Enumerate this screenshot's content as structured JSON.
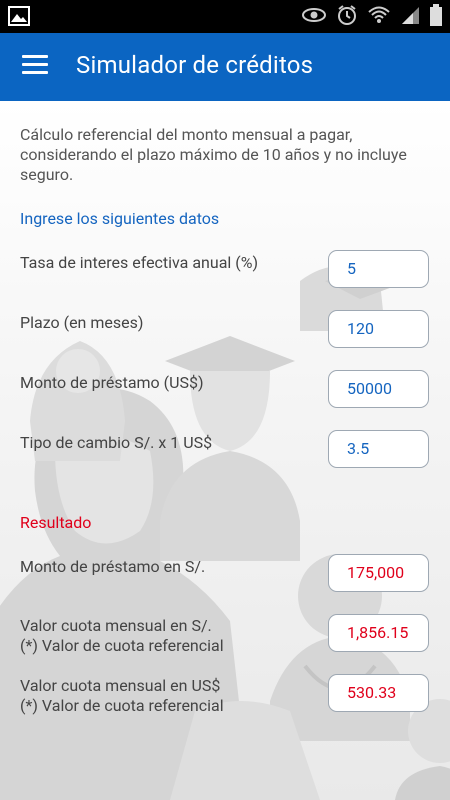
{
  "app": {
    "title": "Simulador de créditos"
  },
  "intro_text": "Cálculo referencial del monto mensual a pagar, considerando el plazo máximo de 10 años y no incluye seguro.",
  "input_section": {
    "header": "Ingrese los siguientes datos",
    "fields": [
      {
        "label": "Tasa de interes efectiva anual (%)",
        "value": "5"
      },
      {
        "label": "Plazo (en meses)",
        "value": "120"
      },
      {
        "label": "Monto de préstamo (US$)",
        "value": "50000"
      },
      {
        "label": "Tipo de cambio S/. x 1 US$",
        "value": "3.5"
      }
    ]
  },
  "result_section": {
    "header": "Resultado",
    "items": [
      {
        "label": "Monto de préstamo en S/.",
        "value": "175,000"
      },
      {
        "label_line1": "Valor cuota mensual en S/.",
        "label_line2": "(*) Valor de cuota referencial",
        "value": "1,856.15"
      },
      {
        "label_line1": "Valor cuota mensual en US$",
        "label_line2": "(*) Valor de cuota referencial",
        "value": "530.33"
      }
    ]
  },
  "colors": {
    "appbar": "#0b65c2",
    "section_header_blue": "#1565c0",
    "section_header_red": "#e0001b",
    "input_text": "#1565c0",
    "result_text": "#e0001b"
  },
  "icons": {
    "status_left": "image-notification-icon",
    "status_right": [
      "eye-icon",
      "alarm-icon",
      "wifi-icon",
      "signal-icon",
      "battery-icon"
    ],
    "appbar": "hamburger-menu-icon"
  }
}
